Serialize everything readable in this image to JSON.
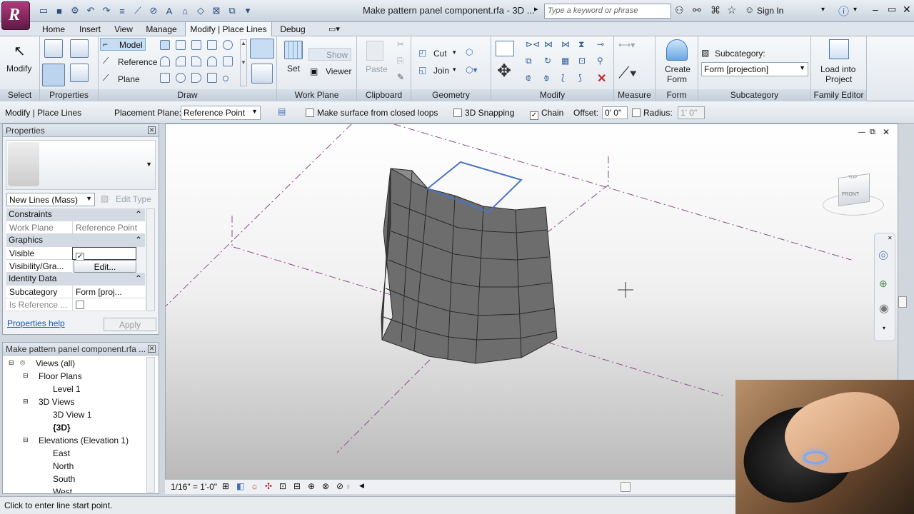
{
  "app": {
    "document_title": "Make pattern panel component.rfa - 3D ...",
    "search_placeholder": "Type a keyword or phrase",
    "sign_in": "Sign In"
  },
  "tabs": [
    "Home",
    "Insert",
    "View",
    "Manage",
    "Modify | Place Lines",
    "Debug"
  ],
  "ribbon": {
    "select": {
      "modify": "Modify",
      "label": "Select"
    },
    "properties": {
      "label": "Properties"
    },
    "draw": {
      "model": "Model",
      "reference": "Reference",
      "plane": "Plane",
      "label": "Draw"
    },
    "work_plane": {
      "set": "Set",
      "show": "Show",
      "viewer": "Viewer",
      "label": "Work Plane"
    },
    "clipboard": {
      "paste": "Paste",
      "label": "Clipboard"
    },
    "geometry": {
      "cut": "Cut",
      "join": "Join",
      "label": "Geometry"
    },
    "modify": {
      "label": "Modify"
    },
    "measure": {
      "label": "Measure"
    },
    "form": {
      "create_form_1": "Create",
      "create_form_2": "Form",
      "label": "Form"
    },
    "subcategory": {
      "title": "Subcategory:",
      "value": "Form [projection]",
      "label": "Subcategory"
    },
    "family_editor": {
      "load_1": "Load into",
      "load_2": "Project",
      "label": "Family Editor"
    }
  },
  "options_bar": {
    "context": "Modify | Place Lines",
    "placement_plane_label": "Placement Plane:",
    "placement_plane_value": "Reference Point",
    "make_surface": "Make surface from closed loops",
    "snapping_3d": "3D Snapping",
    "chain": "Chain",
    "offset_label": "Offset:",
    "offset_value": "0' 0\"",
    "radius_label": "Radius:",
    "radius_value": "1' 0\""
  },
  "properties_palette": {
    "title": "Properties",
    "type_selector": "New Lines (Mass)",
    "edit_type": "Edit Type",
    "sections": {
      "constraints": "Constraints",
      "graphics": "Graphics",
      "identity": "Identity Data"
    },
    "rows": {
      "work_plane": [
        "Work Plane",
        "Reference Point"
      ],
      "visible": [
        "Visible",
        "✓"
      ],
      "visibility": [
        "Visibility/Gra...",
        "Edit..."
      ],
      "subcategory": [
        "Subcategory",
        "Form [proj..."
      ],
      "is_reference": [
        "Is Reference ...",
        ""
      ]
    },
    "help": "Properties help",
    "apply": "Apply"
  },
  "project_browser": {
    "title": "Make pattern panel component.rfa ...",
    "nodes": {
      "views_all": "Views (all)",
      "floor_plans": "Floor Plans",
      "level1": "Level 1",
      "views3d": "3D Views",
      "view3d1": "3D View 1",
      "current3d": "{3D}",
      "elevations": "Elevations (Elevation 1)",
      "east": "East",
      "north": "North",
      "south": "South",
      "west": "West"
    }
  },
  "view_control_bar": {
    "scale": "1/16\" = 1'-0\""
  },
  "viewcube": {
    "top": "TOP",
    "front": "FRONT"
  },
  "status_bar": {
    "message": "Click to enter line start point."
  },
  "colors": {
    "accent": "#3e6fb5",
    "tab_active_bg": "#f3f6f9",
    "panel_label_bg": "#c4cfdb",
    "sketch_line": "#4a74c4"
  }
}
